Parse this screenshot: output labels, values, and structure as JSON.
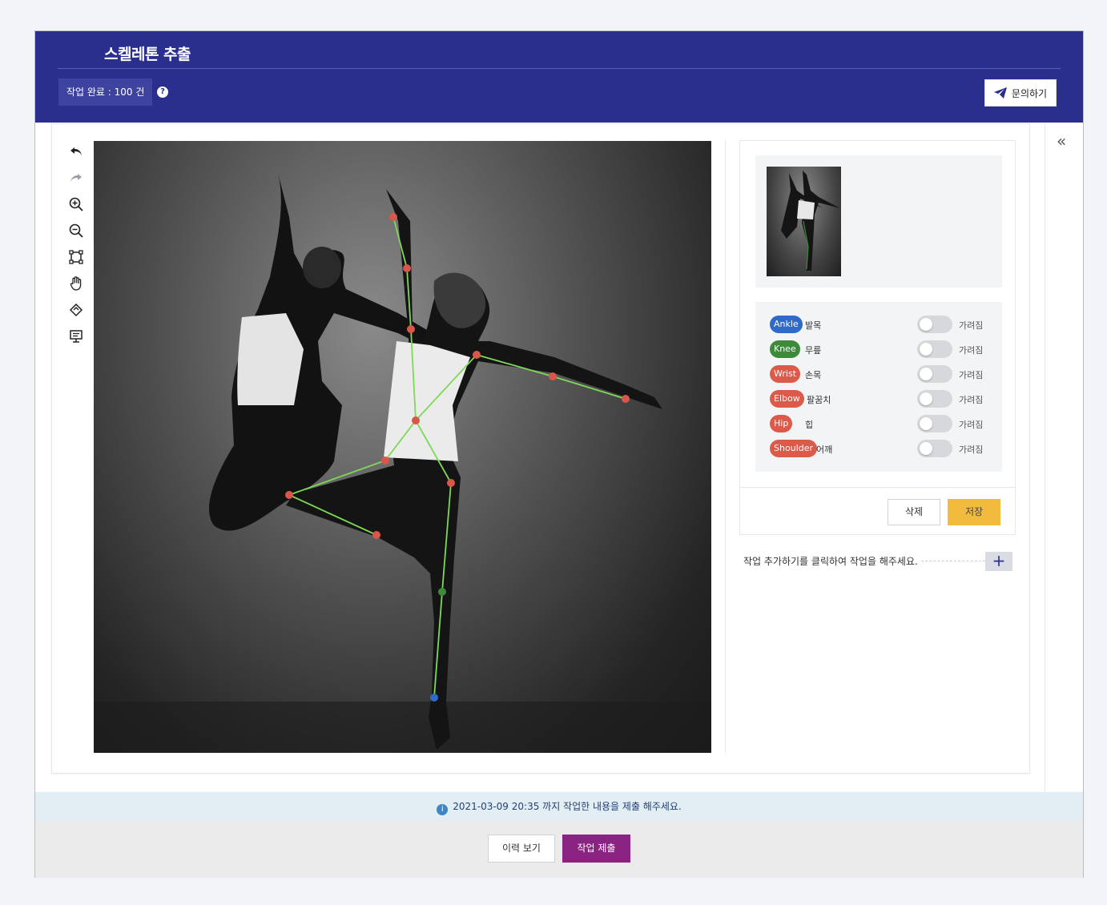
{
  "header": {
    "title": "스켈레톤 추출",
    "task_count": "작업 완료 : 100 건",
    "help_symbol": "?",
    "inquiry_label": "문의하기"
  },
  "toolbar": {
    "tools": [
      "undo-icon",
      "redo-icon",
      "zoom-in-icon",
      "zoom-out-icon",
      "fit-screen-icon",
      "hand-pan-icon",
      "rotate-icon",
      "presentation-icon"
    ]
  },
  "keypoints": [
    {
      "badge": "Ankle",
      "name": "발목",
      "color": "#2f6ac6",
      "state": "가려짐"
    },
    {
      "badge": "Knee",
      "name": "무릎",
      "color": "#3d8a3b",
      "state": "가려짐"
    },
    {
      "badge": "Wrist",
      "name": "손목",
      "color": "#db5a4a",
      "state": "가려짐"
    },
    {
      "badge": "Elbow",
      "name": "팔꿈치",
      "color": "#db5a4a",
      "state": "가려짐"
    },
    {
      "badge": "Hip",
      "name": "힙",
      "color": "#db5a4a",
      "state": "가려짐"
    },
    {
      "badge": "Shoulder",
      "name": "어깨",
      "color": "#db5a4a",
      "state": "가려짐"
    }
  ],
  "actions": {
    "delete_label": "삭제",
    "save_label": "저장",
    "add_hint": "작업 추가하기를 클릭하여 작업을 해주세요.",
    "add_symbol": "+"
  },
  "side": {
    "collapse_symbol": "«"
  },
  "footer": {
    "info_symbol": "i",
    "notice": "2021-03-09 20:35 까지 작업한 내용을 제출 해주세요.",
    "history_label": "이력 보기",
    "submit_label": "작업 제출"
  },
  "colors": {
    "header_bg": "#2a2f8d",
    "accent_purple": "#8a2382",
    "save_yellow": "#f2bb3c",
    "skeleton_line": "#7ed957",
    "joint_red": "#d9574a",
    "joint_green": "#3d8a3b",
    "joint_blue": "#2f6ac6"
  }
}
